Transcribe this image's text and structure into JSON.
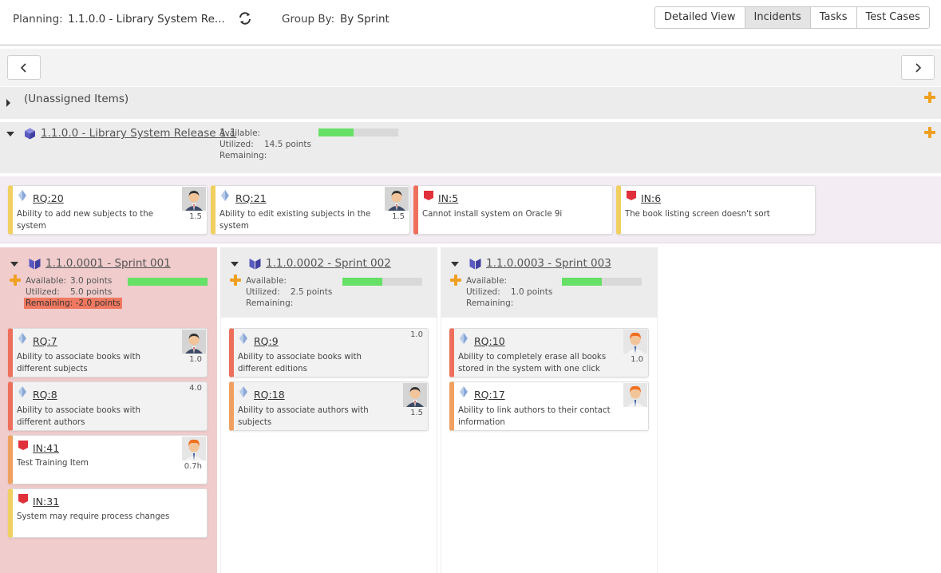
{
  "topbar": {
    "planning_label": "Planning:",
    "planning_value": "1.1.0.0 - Library System Re...",
    "group_label": "Group By:",
    "group_value": "By Sprint",
    "views": [
      "Detailed View",
      "Incidents",
      "Tasks",
      "Test Cases"
    ],
    "active_view": "Incidents"
  },
  "unassigned": {
    "label": "(Unassigned Items)"
  },
  "release": {
    "title": "1.1.0.0 - Library System Release 1.1",
    "available_label": "Available:",
    "utilized_label": "Utilized:",
    "utilized_value": "14.5 points",
    "remaining_label": "Remaining:",
    "progress_fraction": 0.44,
    "cards": [
      {
        "id": "RQ:20",
        "type": "requirement",
        "desc": "Ability to add new subjects to the system",
        "est": "1.5",
        "avatar": "man-dark"
      },
      {
        "id": "RQ:21",
        "type": "requirement",
        "desc": "Ability to edit existing subjects in the system",
        "est": "1.5",
        "avatar": "man-dark"
      },
      {
        "id": "IN:5",
        "type": "incident",
        "desc": "Cannot install system on Oracle 9i"
      },
      {
        "id": "IN:6",
        "type": "incident",
        "desc": "The book listing screen doesn't sort"
      }
    ]
  },
  "sprints": [
    {
      "title": "1.1.0.0001 - Sprint 001",
      "available_label": "Available:",
      "available_value": "3.0 points",
      "utilized_label": "Utilized:",
      "utilized_value": "5.0 points",
      "remaining_label": "Remaining:",
      "remaining_value": "Remaining: -2.0 points",
      "progress_fraction": 1.0,
      "cards": [
        {
          "id": "RQ:7",
          "type": "requirement",
          "desc": "Ability to associate books with different subjects",
          "est": "1.0",
          "avatar": "man-dark"
        },
        {
          "id": "RQ:8",
          "type": "requirement",
          "desc": "Ability to associate books with different authors",
          "est": "4.0"
        },
        {
          "id": "IN:41",
          "type": "incident",
          "desc": "Test Training Item",
          "est": "0.7h",
          "avatar": "man-red"
        },
        {
          "id": "IN:31",
          "type": "incident",
          "desc": "System may require process changes"
        }
      ]
    },
    {
      "title": "1.1.0.0002 - Sprint 002",
      "available_label": "Available:",
      "utilized_label": "Utilized:",
      "utilized_value": "2.5 points",
      "remaining_label": "Remaining:",
      "progress_fraction": 0.5,
      "cards": [
        {
          "id": "RQ:9",
          "type": "requirement",
          "desc": "Ability to associate books with different editions",
          "est": "1.0"
        },
        {
          "id": "RQ:18",
          "type": "requirement",
          "desc": "Ability to associate authors with subjects",
          "est": "1.5",
          "avatar": "man-dark"
        }
      ]
    },
    {
      "title": "1.1.0.0003 - Sprint 003",
      "available_label": "Available:",
      "utilized_label": "Utilized:",
      "utilized_value": "1.0 points",
      "remaining_label": "Remaining:",
      "progress_fraction": 0.5,
      "cards": [
        {
          "id": "RQ:10",
          "type": "requirement",
          "desc": "Ability to completely erase all books stored in the system with one click",
          "est": "1.0",
          "avatar": "man-red"
        },
        {
          "id": "RQ:17",
          "type": "requirement",
          "desc": "Ability to link authors to their contact information",
          "avatar": "man-red"
        }
      ]
    }
  ],
  "colors": {
    "accent_plus": "#f0a020",
    "progress_green": "#66e066",
    "overloaded_bg": "#f0cccc",
    "remaining_badge": "#f07860",
    "incident_flag": "#e0303a",
    "requirement_diamond": "#8aa8d8"
  }
}
